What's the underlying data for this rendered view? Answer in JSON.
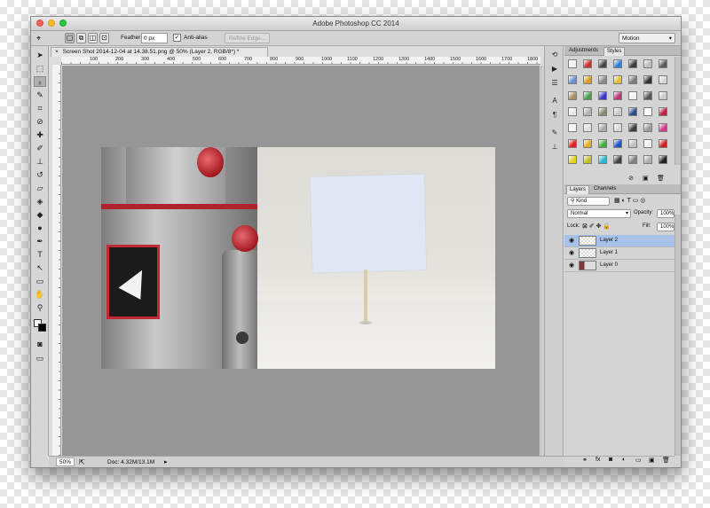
{
  "window": {
    "title": "Adobe Photoshop CC 2014"
  },
  "options_bar": {
    "tool_icon": "polygonal-lasso-icon",
    "feather_label": "Feather:",
    "feather_value": "0 px",
    "anti_alias_label": "Anti-alias",
    "anti_alias_checked": true,
    "refine_edge_label": "Refine Edge...",
    "workspace_value": "Motion"
  },
  "document": {
    "tab_label": "Screen Shot 2014-12-04 at 14.38.51.png @ 50% (Layer 2, RGB/8*) *",
    "tab_close": "×",
    "ruler_ticks": [
      "100",
      "200",
      "300",
      "400",
      "500",
      "600",
      "700",
      "800",
      "900",
      "1000",
      "1100",
      "1200",
      "1300",
      "1400",
      "1500",
      "1600",
      "1700",
      "1800"
    ]
  },
  "status": {
    "zoom": "50%",
    "doc_info": "Doc: 4.32M/13.1M"
  },
  "tools": [
    {
      "name": "move-tool",
      "glyph": "➤"
    },
    {
      "name": "marquee-tool",
      "glyph": "⬚"
    },
    {
      "name": "lasso-tool",
      "glyph": "♁"
    },
    {
      "name": "quick-selection-tool",
      "glyph": "✎"
    },
    {
      "name": "crop-tool",
      "glyph": "⌗"
    },
    {
      "name": "eyedropper-tool",
      "glyph": "⊘"
    },
    {
      "name": "healing-brush-tool",
      "glyph": "✚"
    },
    {
      "name": "brush-tool",
      "glyph": "✐"
    },
    {
      "name": "clone-stamp-tool",
      "glyph": "⊥"
    },
    {
      "name": "history-brush-tool",
      "glyph": "↺"
    },
    {
      "name": "eraser-tool",
      "glyph": "▱"
    },
    {
      "name": "paint-bucket-tool",
      "glyph": "◈"
    },
    {
      "name": "blur-tool",
      "glyph": "◆"
    },
    {
      "name": "dodge-tool",
      "glyph": "●"
    },
    {
      "name": "pen-tool",
      "glyph": "✒"
    },
    {
      "name": "type-tool",
      "glyph": "T"
    },
    {
      "name": "path-selection-tool",
      "glyph": "↖"
    },
    {
      "name": "shape-tool",
      "glyph": "▭"
    },
    {
      "name": "hand-tool",
      "glyph": "✋"
    },
    {
      "name": "zoom-tool",
      "glyph": "⚲"
    }
  ],
  "styles_panel": {
    "tabs": [
      "Adjustments",
      "Styles"
    ],
    "active_tab": "Styles",
    "swatch_colors": [
      "#f2f2f2",
      "#c83030",
      "#444444",
      "#2e80d8",
      "#3c3c3c",
      "#bdbdbd",
      "#5a5a5a",
      "#6a8fd0",
      "#d4a020",
      "#888888",
      "#e0c030",
      "#7a7a7a",
      "#2f2f2f",
      "#d5d5d5",
      "#a89066",
      "#4c9b4c",
      "#3a3abf",
      "#c03070",
      "#f0f0f0",
      "#555555",
      "#c9c9c9",
      "#e8e8e8",
      "#b0b0b0",
      "#8a8a70",
      "#c9c9c9",
      "#2a4a8a",
      "#ffffff",
      "#c02040",
      "#f4f4f4",
      "#e0e0e0",
      "#a8a8a8",
      "#d8d8d8",
      "#3a3a3a",
      "#999999",
      "#d03a90",
      "#e02020",
      "#e0b020",
      "#40b040",
      "#2050d0",
      "#c0c0c0",
      "#f0f0f0",
      "#d02020",
      "#e0d020",
      "#c0c020",
      "#30b0d0",
      "#404040",
      "#808080",
      "#b0b0b0",
      "#202020"
    ]
  },
  "layers_panel": {
    "tabs": [
      "Layers",
      "Channels"
    ],
    "active_tab": "Layers",
    "kind_label": "Kind",
    "blend_mode": "Normal",
    "opacity_label": "Opacity:",
    "opacity_value": "100%",
    "lock_label": "Lock:",
    "fill_label": "Fill:",
    "fill_value": "100%",
    "layers": [
      {
        "name": "Layer 2",
        "selected": true,
        "visible": true,
        "thumb": "transparent"
      },
      {
        "name": "Layer 1",
        "selected": false,
        "visible": true,
        "thumb": "transparent"
      },
      {
        "name": "Layer 0",
        "selected": false,
        "visible": true,
        "thumb": "photo"
      }
    ]
  }
}
